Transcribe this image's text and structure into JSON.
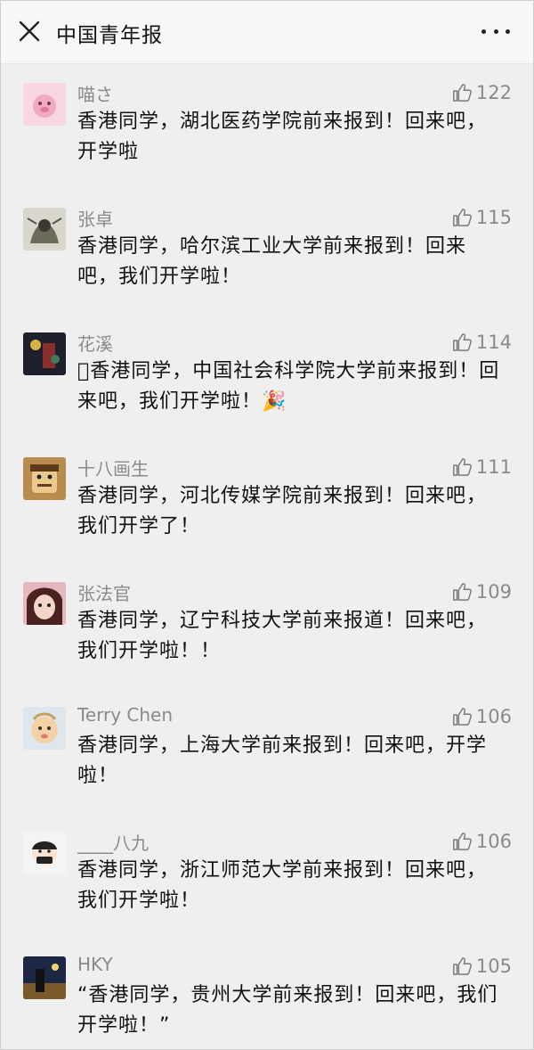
{
  "header": {
    "title": "中国青年报",
    "close_icon": "close-icon",
    "more_icon": "more-icon"
  },
  "comments": [
    {
      "name": "喵さ",
      "likes": "122",
      "text": "香港同学，湖北医药学院前来报到！回来吧，开学啦",
      "avatar": "pink"
    },
    {
      "name": "张卓",
      "likes": "115",
      "text": "香港同学，哈尔滨工业大学前来报到！回来吧，我们开学啦！",
      "avatar": "ink"
    },
    {
      "name": "花溪",
      "likes": "114",
      "text": "􀀁香港同学，中国社会科学院大学前来报到！回来吧，我们开学啦！",
      "emoji": "🎉",
      "avatar": "dark"
    },
    {
      "name": "十八画生",
      "likes": "111",
      "text": "香港同学，河北传媒学院前来报到！回来吧，我们开学了！",
      "avatar": "cartoon"
    },
    {
      "name": "张法官",
      "likes": "109",
      "text": "香港同学，辽宁科技大学前来报道！回来吧，我们开学啦！！",
      "avatar": "girl"
    },
    {
      "name": "Terry Chen",
      "likes": "106",
      "text": "香港同学，上海大学前来报到！回来吧，开学啦！",
      "avatar": "baby"
    },
    {
      "name": "____八九",
      "likes": "106",
      "text": "香港同学，浙江师范大学前来报到！回来吧，我们开学啦！",
      "avatar": "mask"
    },
    {
      "name": "HKY",
      "likes": "105",
      "text": "“香港同学，贵州大学前来报到！回来吧，我们开学啦！”",
      "avatar": "night"
    }
  ]
}
